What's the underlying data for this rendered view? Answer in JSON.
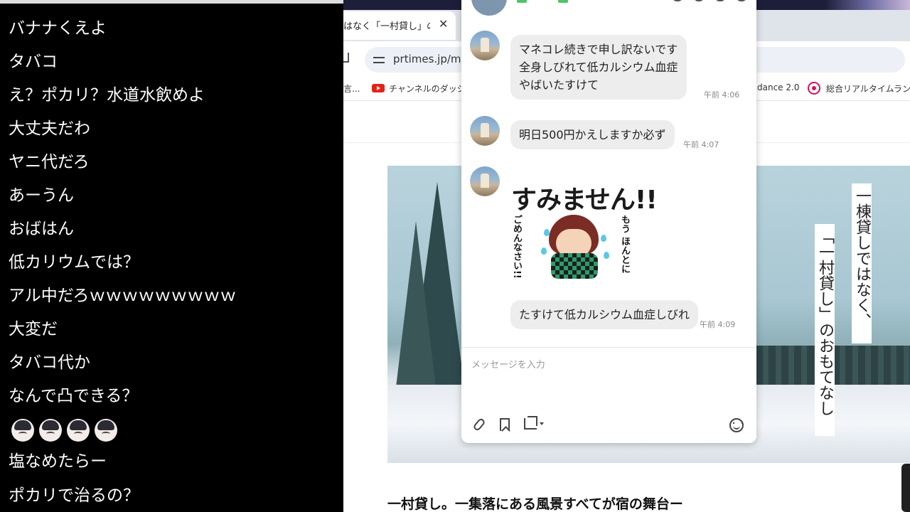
{
  "comments": [
    "バナナくえよ",
    "タバコ",
    "え？ポカリ？水道水飲めよ",
    "大丈夫だわ",
    "ヤニ代だろ",
    "あーうん",
    "おばはん",
    "低カリウムでは？",
    "アル中だろｗｗｗｗｗｗｗｗｗ",
    "大変だ",
    "タバコ代か",
    "なんで凸できる？",
    "塩なめたらー",
    "ポカリで治るの？"
  ],
  "browser": {
    "tab_title": "はなく「一村貸し」のおも",
    "tab_close": "✕",
    "url": "prtimes.jp/ma",
    "bookmarks": {
      "left_fragment": "言...",
      "youtube": "チャンネルのダッシュ",
      "dance": "dance 2.0",
      "ranking": "総合リアルタイムランキ"
    },
    "hero_vertical_1": "一棟貸しではなく、",
    "hero_vertical_2": "「一村貸し」のおもてなし",
    "hero_partial": "゛\n冫",
    "caption": "一村貸し。一集落にある風景すべてが宿の舞台ー"
  },
  "chat": {
    "messages": [
      {
        "text": "マネコレ続きで申し訳ないです\n全身しびれて低カルシウム血症\nやばいたすけて",
        "time": "午前 4:06"
      },
      {
        "text": "明日500円かえしますか必ず",
        "time": "午前 4:07"
      },
      {
        "text": "たすけて低カルシウム血症しびれ",
        "time": "午前 4:09"
      }
    ],
    "sticker": {
      "main": "すみません!!",
      "right": "もう ほんとに",
      "left": "ごめんなさい!!"
    },
    "input_placeholder": "メッセージを入力"
  }
}
